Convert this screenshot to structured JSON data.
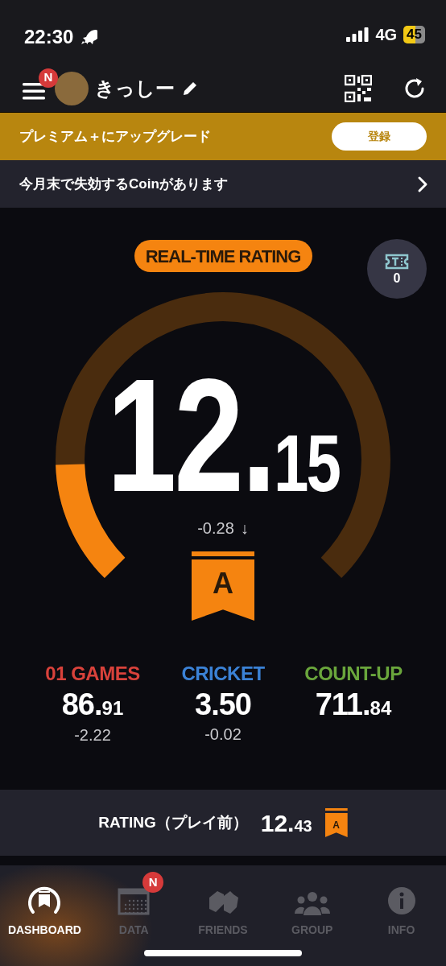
{
  "status_bar": {
    "time": "22:30",
    "network": "4G",
    "battery": "45"
  },
  "header": {
    "menu_badge": "N",
    "user_name": "きっしー"
  },
  "premium_banner": {
    "text": "プレミアム＋にアップグレード",
    "button": "登録"
  },
  "coin_notice": {
    "text": "今月末で失効するCoinがあります"
  },
  "realtime": {
    "label": "REAL-TIME RATING",
    "ticket_count": "0",
    "whole": "12.",
    "fraction": "15",
    "level": 0.16,
    "delta": "-0.28",
    "trend_arrow": "↓",
    "rank": "A"
  },
  "stats": [
    {
      "label": "01 GAMES",
      "color": "#d9423b",
      "whole": "86.",
      "fraction": "91",
      "delta": "-2.22"
    },
    {
      "label": "CRICKET",
      "color": "#3b82d6",
      "whole": "3.50",
      "delta": "-0.02"
    },
    {
      "label": "COUNT-UP",
      "color": "#6aa63c",
      "whole": "711.",
      "fraction": "84"
    }
  ],
  "previous_rating": {
    "label": "RATING（プレイ前）",
    "whole": "12.",
    "fraction": "43",
    "rank": "A"
  },
  "tabs": [
    {
      "label": "DASHBOARD",
      "kind": "dashboard",
      "selected": true
    },
    {
      "label": "DATA",
      "kind": "data",
      "selected": false,
      "badge": "N"
    },
    {
      "label": "FRIENDS",
      "kind": "friends",
      "selected": false
    },
    {
      "label": "GROUP",
      "kind": "group",
      "selected": false
    },
    {
      "label": "INFO",
      "kind": "info",
      "selected": false
    }
  ]
}
